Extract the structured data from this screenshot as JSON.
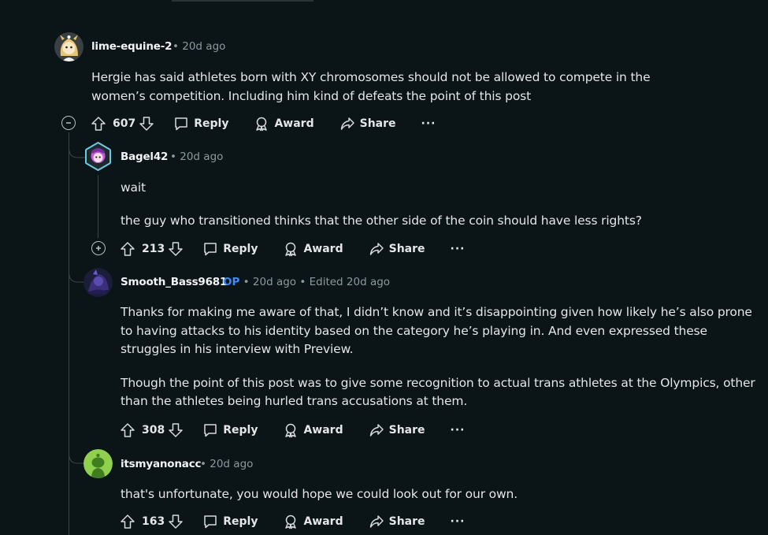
{
  "comments": [
    {
      "username": "lime-equine-2",
      "op": "",
      "meta": "• 20d ago",
      "paragraphs": [
        "Hergie has said athletes born with XY chromosomes should not be allowed to compete in the women’s competition. Including him kind of defeats the point of this post"
      ],
      "votes": "607",
      "avatar_icon": "anime-avatar-icon",
      "collapse_icon": "minus"
    },
    {
      "username": "Bagel42",
      "op": "",
      "meta": "• 20d ago",
      "paragraphs": [
        "wait",
        "the guy who transitioned thinks that the other side of the coin should have less rights?"
      ],
      "votes": "213",
      "avatar_icon": "hexagon-avatar-icon",
      "collapse_icon": "plus"
    },
    {
      "username": "Smooth_Bass9681",
      "op": "OP",
      "meta": "• 20d ago • Edited 20d ago",
      "paragraphs": [
        "Thanks for making me aware of that, I didn’t know and it’s disappointing given how likely he’s also prone to having attacks to his identity based on the category he’s playing in. And even expressed these struggles in his interview with Preview.",
        "Though the point of this post was to give some recognition to actual trans athletes at the Olympics, other than the athletes being hurled trans accusations at them."
      ],
      "votes": "308",
      "avatar_icon": "dark-avatar-icon"
    },
    {
      "username": "itsmyanonacc",
      "op": "",
      "meta": "• 20d ago",
      "paragraphs": [
        "that's unfortunate, you would hope we could look out for our own."
      ],
      "votes": "163",
      "avatar_icon": "snoo-avatar-icon"
    }
  ],
  "actions": {
    "reply": "Reply",
    "award": "Award",
    "share": "Share",
    "more": "···"
  },
  "colors": {
    "background": "#0b1416",
    "text": "#e4e6e8",
    "meta": "#8a9a9f",
    "op": "#3d8bfd",
    "thread_line": "#3e4548"
  }
}
